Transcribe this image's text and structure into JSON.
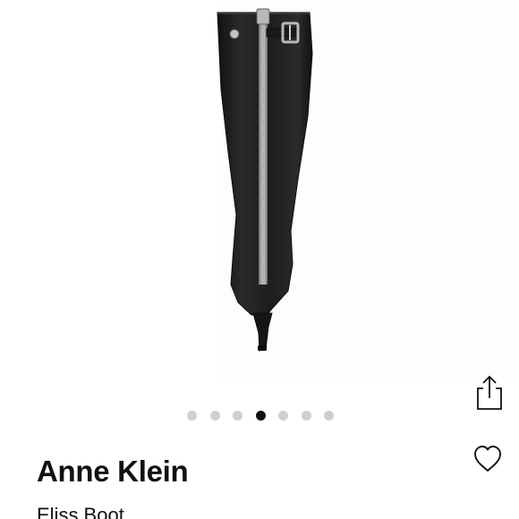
{
  "product": {
    "brand": "Anne Klein",
    "name": "Eliss Boot"
  },
  "gallery": {
    "image_alt": "black knee-high stiletto boot, rear view",
    "dot_count": 7,
    "active_index": 3
  },
  "actions": {
    "share_icon": "share-icon",
    "favorite_icon": "heart-outline-icon"
  },
  "colors": {
    "text": "#111111",
    "dot_inactive": "#cfcfcf",
    "dot_active": "#111111",
    "boot": "#1c1c1e"
  }
}
